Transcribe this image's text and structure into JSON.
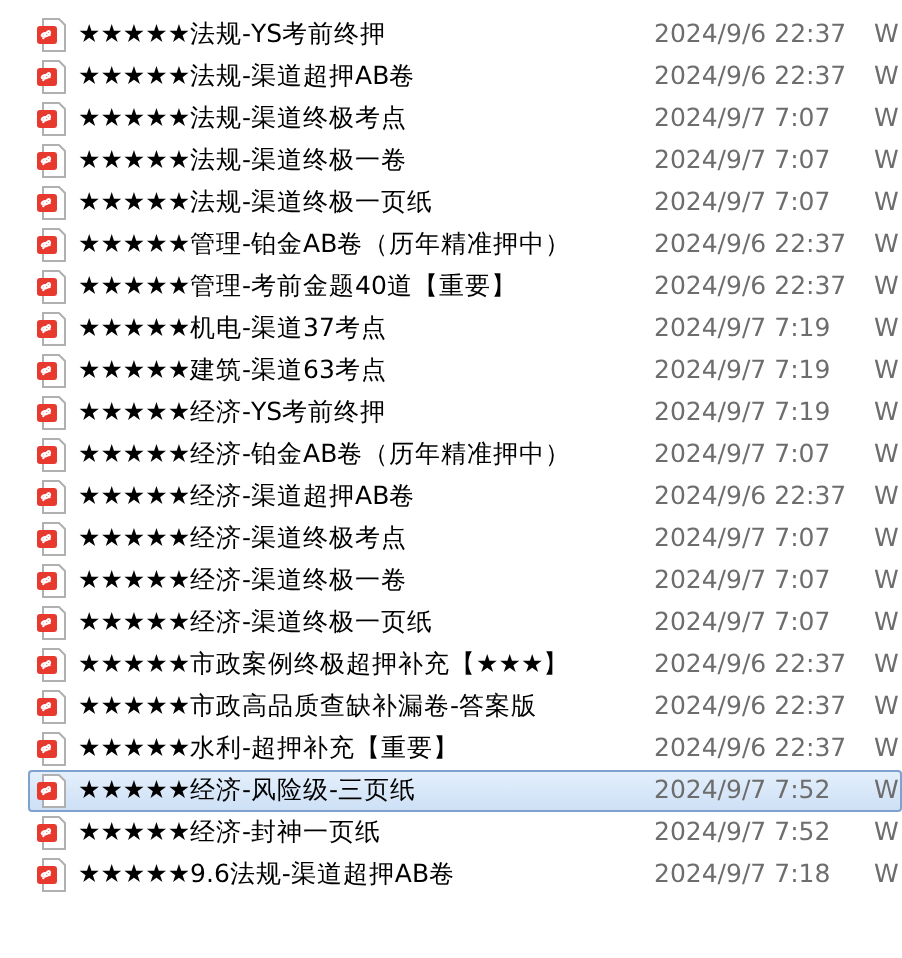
{
  "files": [
    {
      "name": "★★★★★法规-YS考前终押",
      "modified": "2024/9/6 22:37",
      "column_3": "W",
      "selected": false
    },
    {
      "name": "★★★★★法规-渠道超押AB卷",
      "modified": "2024/9/6 22:37",
      "column_3": "W",
      "selected": false
    },
    {
      "name": "★★★★★法规-渠道终极考点",
      "modified": "2024/9/7 7:07",
      "column_3": "W",
      "selected": false
    },
    {
      "name": "★★★★★法规-渠道终极一卷",
      "modified": "2024/9/7 7:07",
      "column_3": "W",
      "selected": false
    },
    {
      "name": "★★★★★法规-渠道终极一页纸",
      "modified": "2024/9/7 7:07",
      "column_3": "W",
      "selected": false
    },
    {
      "name": "★★★★★管理-铂金AB卷（历年精准押中）",
      "modified": "2024/9/6 22:37",
      "column_3": "W",
      "selected": false
    },
    {
      "name": "★★★★★管理-考前金题40道【重要】",
      "modified": "2024/9/6 22:37",
      "column_3": "W",
      "selected": false
    },
    {
      "name": "★★★★★机电-渠道37考点",
      "modified": "2024/9/7 7:19",
      "column_3": "W",
      "selected": false
    },
    {
      "name": "★★★★★建筑-渠道63考点",
      "modified": "2024/9/7 7:19",
      "column_3": "W",
      "selected": false
    },
    {
      "name": "★★★★★经济-YS考前终押",
      "modified": "2024/9/7 7:19",
      "column_3": "W",
      "selected": false
    },
    {
      "name": "★★★★★经济-铂金AB卷（历年精准押中）",
      "modified": "2024/9/7 7:07",
      "column_3": "W",
      "selected": false
    },
    {
      "name": "★★★★★经济-渠道超押AB卷",
      "modified": "2024/9/6 22:37",
      "column_3": "W",
      "selected": false
    },
    {
      "name": "★★★★★经济-渠道终极考点",
      "modified": "2024/9/7 7:07",
      "column_3": "W",
      "selected": false
    },
    {
      "name": "★★★★★经济-渠道终极一卷",
      "modified": "2024/9/7 7:07",
      "column_3": "W",
      "selected": false
    },
    {
      "name": "★★★★★经济-渠道终极一页纸",
      "modified": "2024/9/7 7:07",
      "column_3": "W",
      "selected": false
    },
    {
      "name": "★★★★★市政案例终极超押补充【★★★】",
      "modified": "2024/9/6 22:37",
      "column_3": "W",
      "selected": false
    },
    {
      "name": "★★★★★市政高品质查缺补漏卷-答案版",
      "modified": "2024/9/6 22:37",
      "column_3": "W",
      "selected": false
    },
    {
      "name": "★★★★★水利-超押补充【重要】",
      "modified": "2024/9/6 22:37",
      "column_3": "W",
      "selected": false
    },
    {
      "name": "★★★★★经济-风险级-三页纸",
      "modified": "2024/9/7 7:52",
      "column_3": "W",
      "selected": true
    },
    {
      "name": "★★★★★经济-封神一页纸",
      "modified": "2024/9/7 7:52",
      "column_3": "W",
      "selected": false
    },
    {
      "name": "★★★★★9.6法规-渠道超押AB卷",
      "modified": "2024/9/7 7:18",
      "column_3": "W",
      "selected": false
    }
  ]
}
